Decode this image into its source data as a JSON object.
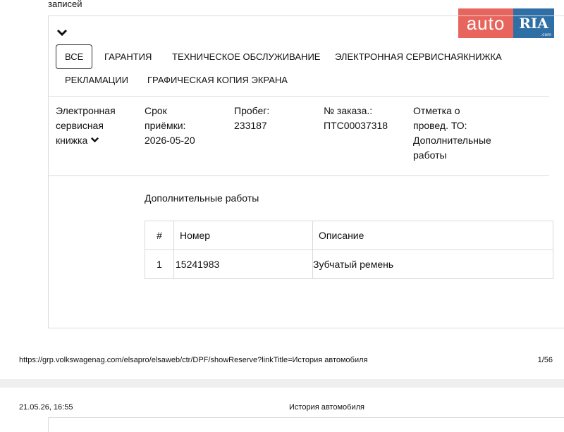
{
  "header_fragment": "записей",
  "tabs": [
    {
      "label": "ВСЕ",
      "active": true
    },
    {
      "label": "ГАРАНТИЯ",
      "active": false
    },
    {
      "label": "ТЕХНИЧЕСКОЕ ОБСЛУЖИВАНИЕ",
      "active": false
    },
    {
      "label": "ЭЛЕКТРОННАЯ СЕРВИСНАЯКНИЖКА",
      "active": false
    },
    {
      "label": "РЕКЛАМАЦИИ",
      "active": false
    },
    {
      "label": "ГРАФИЧЕСКАЯ КОПИЯ ЭКРАНА",
      "active": false
    }
  ],
  "record": {
    "type_line1": "Электронная",
    "type_line2": "сервисная",
    "type_line3": "книжка",
    "date_label_1": "Срок",
    "date_label_2": "приёмки:",
    "date_value": "2026-05-20",
    "mileage_label": "Пробег:",
    "mileage_value": "233187",
    "order_label": "№ заказа.:",
    "order_value": "ПТС00037318",
    "mark_line1": "Отметка о",
    "mark_line2": "провед. ТО:",
    "mark_line3": "Дополнительные",
    "mark_line4": "работы"
  },
  "works": {
    "title": "Дополнительные работы",
    "columns": [
      "#",
      "Номер",
      "Описание"
    ],
    "rows": [
      {
        "n": "1",
        "number": "15241983",
        "description": "Зубчатый ремень"
      }
    ]
  },
  "footer": {
    "url": "https://grp.volkswagenag.com/elsapro/elsaweb/ctr/DPF/showReserve?linkTitle=История автомобиля",
    "page": "1/56",
    "date": "21.05.26, 16:55",
    "title": "История автомобиля"
  },
  "watermark": {
    "part1": "auto",
    "part2": "RIA",
    "domain": ".com"
  },
  "colors": {
    "logo_red": "#e8655d",
    "logo_blue": "#2e6fa6",
    "border": "#dcdcdc"
  }
}
